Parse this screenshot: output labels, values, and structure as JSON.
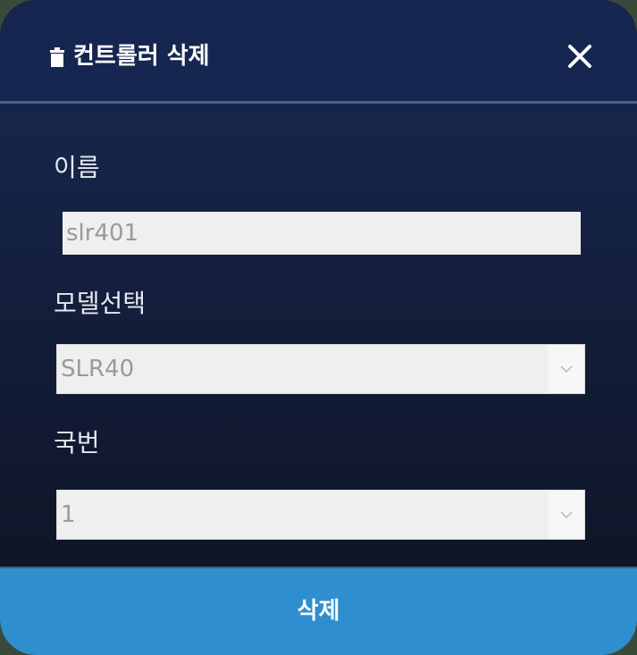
{
  "dialog": {
    "title": "컨트롤러 삭제",
    "title_icon": "trash-icon",
    "close_icon": "close-icon"
  },
  "form": {
    "name": {
      "label": "이름",
      "value": "slr401"
    },
    "model": {
      "label": "모델선택",
      "selected": "SLR40"
    },
    "station": {
      "label": "국번",
      "selected": "1"
    }
  },
  "footer": {
    "delete_label": "삭제"
  },
  "colors": {
    "header_bg": "#152650",
    "body_bg": "#121c36",
    "button_bg": "#2f8ecd",
    "field_bg": "#efefef"
  }
}
